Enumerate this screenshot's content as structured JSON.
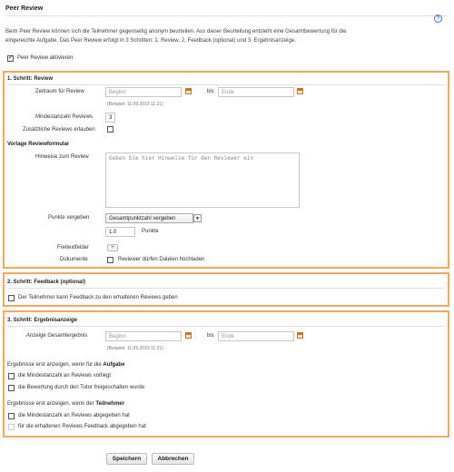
{
  "page": {
    "title": "Peer Review",
    "intro": "Beim Peer Review können sich die Teilnehmer gegenseitig anonym beurteilen. Aus dieser Beurteilung entsteht eine Gesamtbewertung für die eingereichte Aufgabe. Das Peer Review erfolgt in 3 Schritten: 1. Review, 2. Feedback (optional) und 3. Ergebnisanzeige.",
    "activate_label": "Peer Review aktivieren",
    "help_glyph": "?"
  },
  "step1": {
    "heading": "1. Schritt: Review",
    "period_label": "Zeitraum für Review",
    "start_placeholder": "Beginn",
    "bis": "bis",
    "end_placeholder": "Ende",
    "example": "(Beispiel: 11.09.2019 11:21)",
    "min_reviews_label": "Mindestanzahl Reviews",
    "min_reviews_value": "3",
    "extra_reviews_label": "Zusätzliche Reviews erlauben",
    "form_heading": "Vorlage Reviewformular",
    "hints_label": "Hinweise zum Review",
    "hints_placeholder": "Geben Sie hier Hinweise für den Reviewer ein",
    "points_label": "Punkte vergeben",
    "points_select": "Gesamtpunktzahl vergeben",
    "points_value": "1.0",
    "points_unit": "Punkte",
    "freetext_label": "Freitextfelder",
    "add_glyph": "+",
    "documents_label": "Dokumente",
    "upload_label": "Reviewer dürfen Dateien hochladen"
  },
  "step2": {
    "heading": "2. Schritt: Feedback (optional)",
    "feedback_label": "Der Teilnehmer kann Feedback zu den erhaltenen Reviews geben"
  },
  "step3": {
    "heading": "3. Schritt: Ergebnisanzeige",
    "result_label": "Anzeige Gesamtergebnis",
    "start_placeholder": "Beginn",
    "bis": "bis",
    "end_placeholder": "Ende",
    "example": "(Beispiel: 11.09.2019 11:21)",
    "cond_task_prefix": "Ergebnisse erst anzeigen, wenn für die ",
    "cond_task_bold": "Aufgabe",
    "task_opt1": "die Mindestanzahl an Reviews vorliegt",
    "task_opt2": "die Bewertung durch den Tutor freigeschalten wurde",
    "cond_part_prefix": "Ergebnisse erst anzeigen, wenn der ",
    "cond_part_bold": "Teilnehmer",
    "part_opt1": "die Mindestanzahl an Reviews abgegeben hat",
    "part_opt2": "für die erhaltenen Reviews Feedback abgegeben hat"
  },
  "footer": {
    "save_label": "Speichern",
    "cancel_label": "Abbrechen"
  },
  "colors": {
    "panel_border": "#f7a65a",
    "help_icon": "#3a78c4"
  }
}
